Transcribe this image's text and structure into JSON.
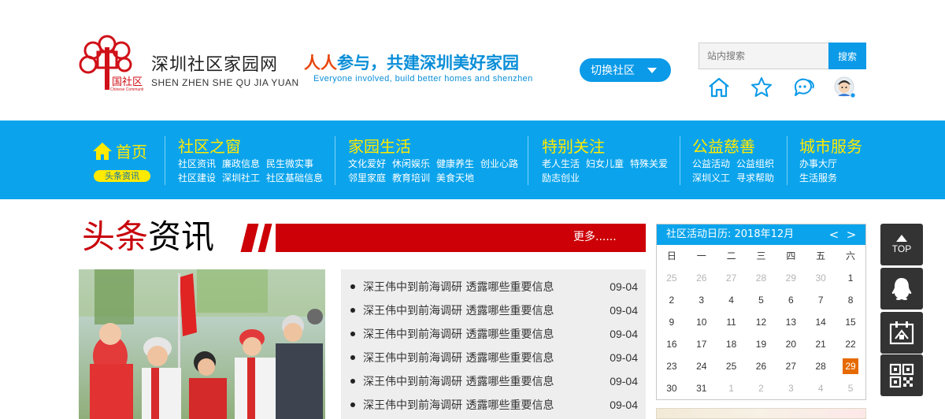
{
  "header": {
    "site_name": "深圳社区家园网",
    "site_pinyin": "SHEN ZHEN SHE QU JIA YUAN",
    "slogan_highlight": "人人",
    "slogan_rest": "参与，共建深圳美好家园",
    "slogan_en": "Everyone involved, build better homes and shenzhen",
    "switch_label": "切换社区",
    "search_placeholder": "站内搜索",
    "search_button": "搜索",
    "icons": [
      "home-icon",
      "star-icon",
      "chat-icon",
      "avatar"
    ]
  },
  "nav": {
    "home": {
      "label": "首页",
      "sub": "头条资讯"
    },
    "columns": [
      {
        "title": "社区之窗",
        "lines": [
          [
            "社区资讯",
            "廉政信息",
            "民生微实事"
          ],
          [
            "社区建设",
            "深圳社工",
            "社区基础信息"
          ]
        ]
      },
      {
        "title": "家园生活",
        "lines": [
          [
            "文化爱好",
            "休闲娱乐",
            "健康养生",
            "创业心路"
          ],
          [
            "邻里家庭",
            "教育培训",
            "美食天地"
          ]
        ]
      },
      {
        "title": "特别关注",
        "lines": [
          [
            "老人生活",
            "妇女儿童",
            "特殊关爱"
          ],
          [
            "励志创业"
          ]
        ]
      },
      {
        "title": "公益慈善",
        "lines": [
          [
            "公益活动",
            "公益组织"
          ],
          [
            "深圳义工",
            "寻求帮助"
          ]
        ]
      },
      {
        "title": "城市服务",
        "lines": [
          [
            "办事大厅"
          ],
          [
            "生活服务"
          ]
        ]
      }
    ]
  },
  "news": {
    "title_red": "头条",
    "title_black": "资讯",
    "more": "更多......",
    "items": [
      {
        "text": "深王伟中到前海调研 透露哪些重要信息",
        "date": "09-04"
      },
      {
        "text": "深王伟中到前海调研 透露哪些重要信息",
        "date": "09-04"
      },
      {
        "text": "深王伟中到前海调研 透露哪些重要信息",
        "date": "09-04"
      },
      {
        "text": "深王伟中到前海调研 透露哪些重要信息",
        "date": "09-04"
      },
      {
        "text": "深王伟中到前海调研 透露哪些重要信息",
        "date": "09-04"
      },
      {
        "text": "深王伟中到前海调研 透露哪些重要信息",
        "date": "09-04"
      }
    ]
  },
  "calendar": {
    "title": "社区活动日历: 2018年12月",
    "prev": "<",
    "next": ">",
    "weekdays": [
      "日",
      "一",
      "二",
      "三",
      "四",
      "五",
      "六"
    ],
    "today": "29",
    "rows": [
      [
        {
          "d": "25",
          "m": true
        },
        {
          "d": "26",
          "m": true
        },
        {
          "d": "27",
          "m": true
        },
        {
          "d": "28",
          "m": true
        },
        {
          "d": "29",
          "m": true
        },
        {
          "d": "30",
          "m": true
        },
        {
          "d": "1",
          "m": false
        }
      ],
      [
        {
          "d": "2",
          "m": false
        },
        {
          "d": "3",
          "m": false
        },
        {
          "d": "4",
          "m": false
        },
        {
          "d": "5",
          "m": false
        },
        {
          "d": "6",
          "m": false
        },
        {
          "d": "7",
          "m": false
        },
        {
          "d": "8",
          "m": false
        }
      ],
      [
        {
          "d": "9",
          "m": false
        },
        {
          "d": "10",
          "m": false
        },
        {
          "d": "11",
          "m": false
        },
        {
          "d": "12",
          "m": false
        },
        {
          "d": "13",
          "m": false
        },
        {
          "d": "14",
          "m": false
        },
        {
          "d": "15",
          "m": false
        }
      ],
      [
        {
          "d": "16",
          "m": false
        },
        {
          "d": "17",
          "m": false
        },
        {
          "d": "18",
          "m": false
        },
        {
          "d": "19",
          "m": false
        },
        {
          "d": "20",
          "m": false
        },
        {
          "d": "21",
          "m": false
        },
        {
          "d": "22",
          "m": false
        }
      ],
      [
        {
          "d": "23",
          "m": false
        },
        {
          "d": "24",
          "m": false
        },
        {
          "d": "25",
          "m": false
        },
        {
          "d": "26",
          "m": false
        },
        {
          "d": "27",
          "m": false
        },
        {
          "d": "28",
          "m": false
        },
        {
          "d": "29",
          "m": false
        }
      ],
      [
        {
          "d": "30",
          "m": false
        },
        {
          "d": "31",
          "m": false
        },
        {
          "d": "1",
          "m": true
        },
        {
          "d": "2",
          "m": true
        },
        {
          "d": "3",
          "m": true
        },
        {
          "d": "4",
          "m": true
        },
        {
          "d": "5",
          "m": true
        }
      ]
    ]
  },
  "sidebar": {
    "top_label": "TOP",
    "buttons": [
      "top-icon",
      "qq-icon",
      "community-icon",
      "qrcode-icon"
    ]
  },
  "colors": {
    "brand_blue": "#0ba4ec",
    "nav_yellow": "#ffea00",
    "news_red": "#cc0006",
    "today_orange": "#e66a00",
    "side_dark": "#333333"
  }
}
